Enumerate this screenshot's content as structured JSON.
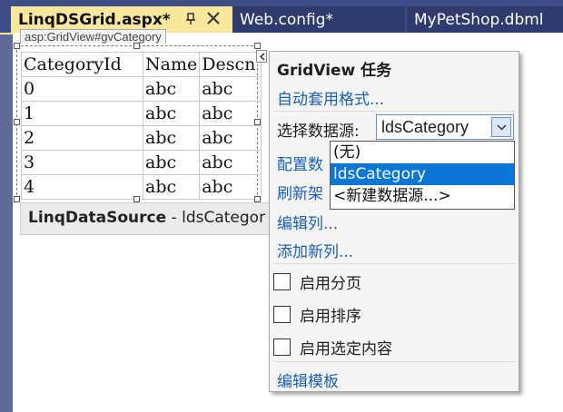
{
  "tabs": [
    {
      "label": "LinqDSGrid.aspx*",
      "active": true
    },
    {
      "label": "Web.config*",
      "active": false
    },
    {
      "label": "MyPetShop.dbml",
      "active": false
    }
  ],
  "designer": {
    "control_tag": "asp:GridView#gvCategory",
    "grid": {
      "headers": [
        "CategoryId",
        "Name",
        "Descn"
      ],
      "rows": [
        [
          "0",
          "abc",
          "abc"
        ],
        [
          "1",
          "abc",
          "abc"
        ],
        [
          "2",
          "abc",
          "abc"
        ],
        [
          "3",
          "abc",
          "abc"
        ],
        [
          "4",
          "abc",
          "abc"
        ]
      ]
    },
    "linq_source": {
      "type": "LinqDataSource",
      "separator": " - ",
      "id": "ldsCategor"
    }
  },
  "task_panel": {
    "title": "GridView 任务",
    "auto_format": "自动套用格式...",
    "datasource_label": "选择数据源:",
    "datasource_value": "ldsCategory",
    "configure": "配置数",
    "refresh": "刷新架",
    "edit_columns": "编辑列...",
    "add_column": "添加新列...",
    "checkboxes": [
      {
        "label": "启用分页",
        "checked": false
      },
      {
        "label": "启用排序",
        "checked": false
      },
      {
        "label": "启用选定内容",
        "checked": false
      }
    ],
    "edit_templates": "编辑模板"
  },
  "dropdown": {
    "options": [
      "(无)",
      "ldsCategory",
      "<新建数据源...>"
    ],
    "selected": "ldsCategory"
  },
  "colors": {
    "tab_active": "#f9e79b",
    "tab_inactive": "#2f3b6e",
    "selection": "#0a76d8",
    "link": "#1a5fb4"
  }
}
